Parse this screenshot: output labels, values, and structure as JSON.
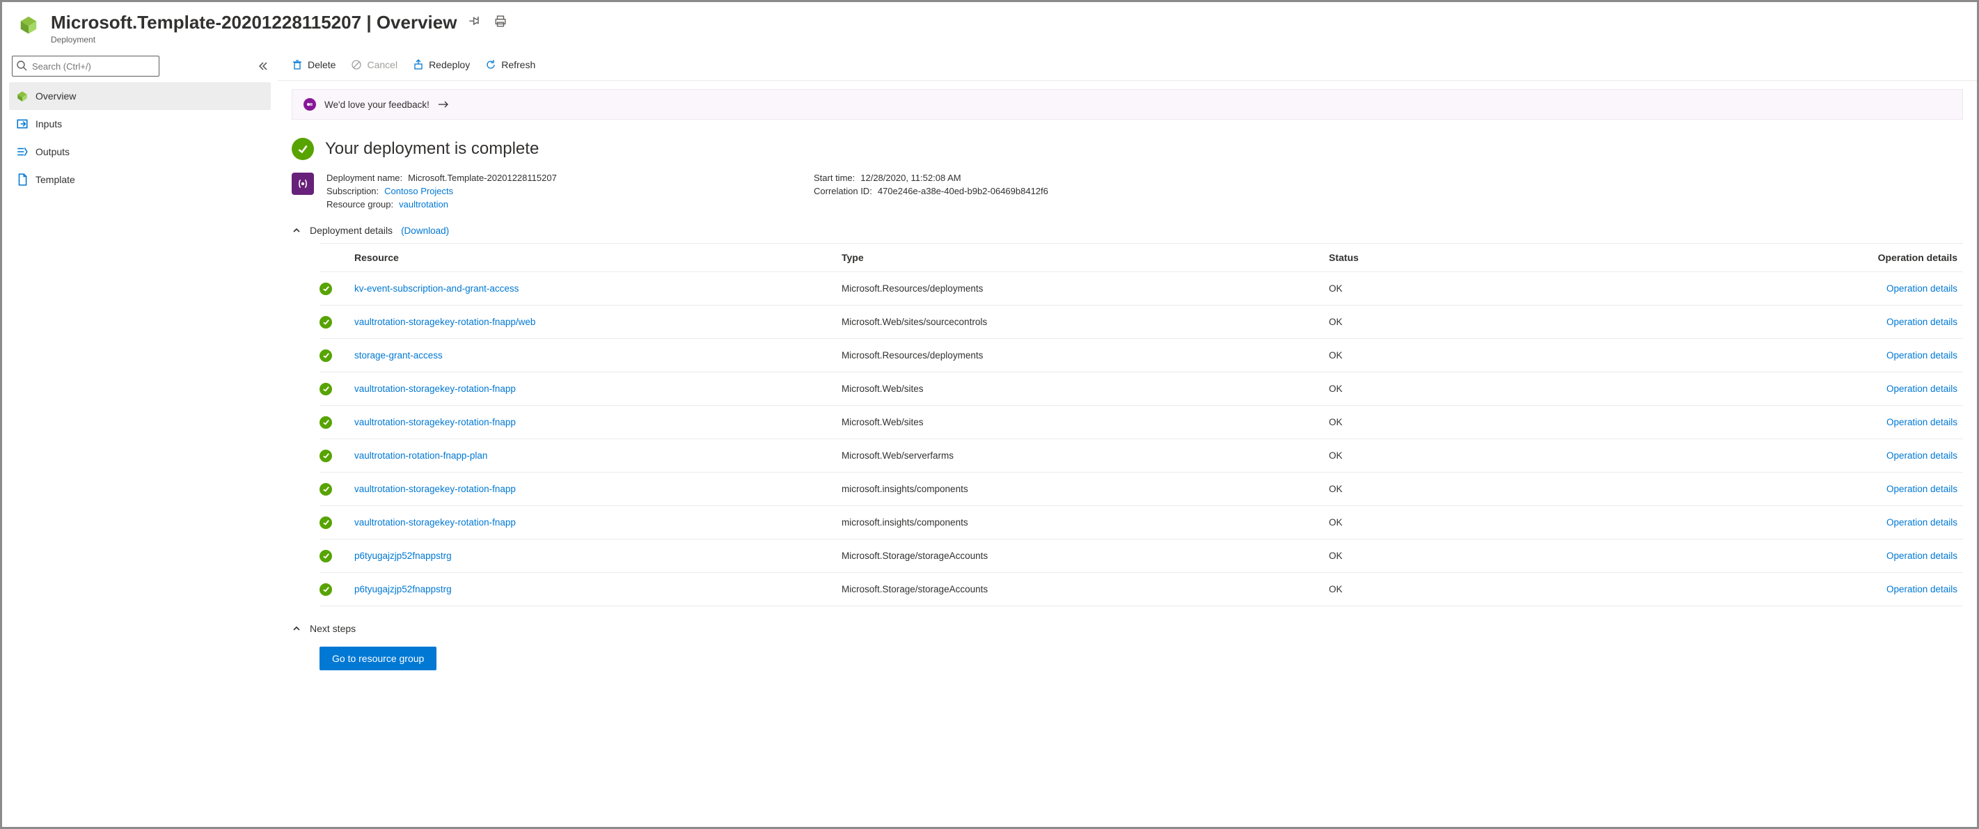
{
  "header": {
    "title": "Microsoft.Template-20201228115207 | Overview",
    "subtitle": "Deployment"
  },
  "sidebar": {
    "search_placeholder": "Search (Ctrl+/)",
    "items": [
      {
        "label": "Overview"
      },
      {
        "label": "Inputs"
      },
      {
        "label": "Outputs"
      },
      {
        "label": "Template"
      }
    ]
  },
  "toolbar": {
    "delete": "Delete",
    "cancel": "Cancel",
    "redeploy": "Redeploy",
    "refresh": "Refresh"
  },
  "feedback": {
    "text": "We'd love your feedback!"
  },
  "status": {
    "title": "Your deployment is complete"
  },
  "meta": {
    "labels": {
      "deployment_name": "Deployment name:",
      "subscription": "Subscription:",
      "resource_group": "Resource group:",
      "start_time": "Start time:",
      "correlation_id": "Correlation ID:"
    },
    "deployment_name": "Microsoft.Template-20201228115207",
    "subscription": "Contoso Projects",
    "resource_group": "vaultrotation",
    "start_time": "12/28/2020, 11:52:08 AM",
    "correlation_id": "470e246e-a38e-40ed-b9b2-06469b8412f6"
  },
  "details": {
    "title": "Deployment details",
    "download": "(Download)",
    "headers": {
      "resource": "Resource",
      "type": "Type",
      "status": "Status",
      "operation_details": "Operation details"
    },
    "op_link": "Operation details",
    "rows": [
      {
        "resource": "kv-event-subscription-and-grant-access",
        "type": "Microsoft.Resources/deployments",
        "status": "OK"
      },
      {
        "resource": "vaultrotation-storagekey-rotation-fnapp/web",
        "type": "Microsoft.Web/sites/sourcecontrols",
        "status": "OK"
      },
      {
        "resource": "storage-grant-access",
        "type": "Microsoft.Resources/deployments",
        "status": "OK"
      },
      {
        "resource": "vaultrotation-storagekey-rotation-fnapp",
        "type": "Microsoft.Web/sites",
        "status": "OK"
      },
      {
        "resource": "vaultrotation-storagekey-rotation-fnapp",
        "type": "Microsoft.Web/sites",
        "status": "OK"
      },
      {
        "resource": "vaultrotation-rotation-fnapp-plan",
        "type": "Microsoft.Web/serverfarms",
        "status": "OK"
      },
      {
        "resource": "vaultrotation-storagekey-rotation-fnapp",
        "type": "microsoft.insights/components",
        "status": "OK"
      },
      {
        "resource": "vaultrotation-storagekey-rotation-fnapp",
        "type": "microsoft.insights/components",
        "status": "OK"
      },
      {
        "resource": "p6tyugajzjp52fnappstrg",
        "type": "Microsoft.Storage/storageAccounts",
        "status": "OK"
      },
      {
        "resource": "p6tyugajzjp52fnappstrg",
        "type": "Microsoft.Storage/storageAccounts",
        "status": "OK"
      }
    ]
  },
  "next_steps": {
    "title": "Next steps",
    "button": "Go to resource group"
  }
}
